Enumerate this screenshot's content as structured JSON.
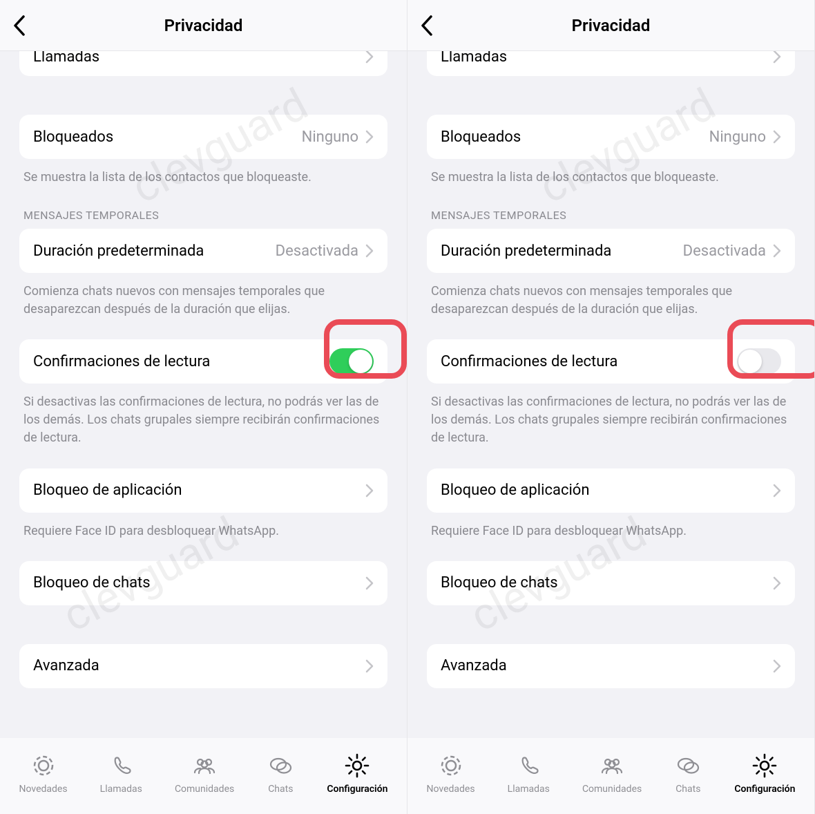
{
  "header": {
    "title": "Privacidad"
  },
  "rows": {
    "llamadas": {
      "label": "Llamadas"
    },
    "bloqueados": {
      "label": "Bloqueados",
      "value": "Ninguno",
      "footer": "Se muestra la lista de los contactos que bloqueaste."
    },
    "temporales": {
      "section": "MENSAJES TEMPORALES",
      "label": "Duración predeterminada",
      "value": "Desactivada",
      "footer": "Comienza chats nuevos con mensajes temporales que desaparezcan después de la duración que elijas."
    },
    "lectura": {
      "label": "Confirmaciones de lectura",
      "footer": "Si desactivas las confirmaciones de lectura, no podrás ver las de los demás. Los chats grupales siempre recibirán confirmaciones de lectura."
    },
    "bloqueo_app": {
      "label": "Bloqueo de aplicación",
      "footer": "Requiere Face ID para desbloquear WhatsApp."
    },
    "bloqueo_chats": {
      "label": "Bloqueo de chats"
    },
    "avanzada": {
      "label": "Avanzada"
    }
  },
  "left": {
    "read_receipts_on": true
  },
  "right": {
    "read_receipts_on": false
  },
  "tabs": {
    "novedades": "Novedades",
    "llamadas": "Llamadas",
    "comunidades": "Comunidades",
    "chats": "Chats",
    "config": "Configuración"
  },
  "watermark": "clevguard",
  "colors": {
    "toggle_on": "#2fce5a",
    "highlight": "#ea4b56"
  }
}
